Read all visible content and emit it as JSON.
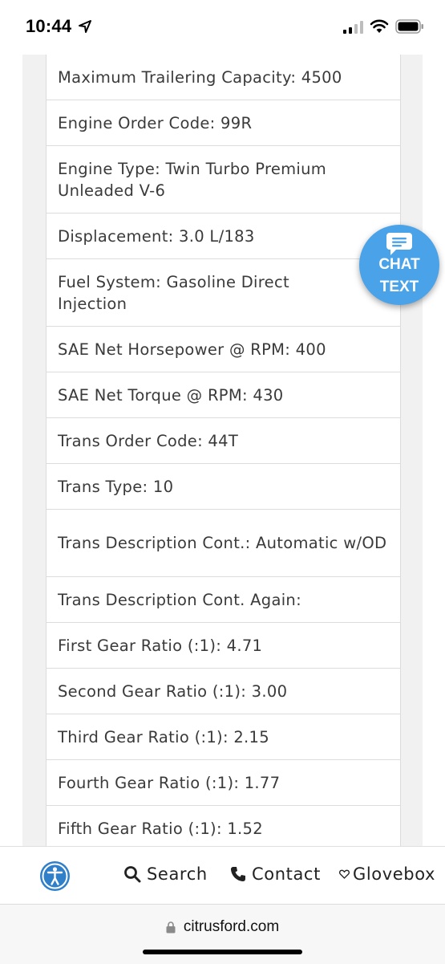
{
  "status_bar": {
    "time": "10:44",
    "icons": [
      "location-arrow-icon",
      "signal-icon",
      "wifi-icon",
      "battery-icon"
    ]
  },
  "specs": [
    {
      "text": "Maximum Trailering Capacity: 4500"
    },
    {
      "text": "Engine Order Code: 99R"
    },
    {
      "text": "Engine Type: Twin Turbo Premium Unleaded V-6"
    },
    {
      "text": "Displacement: 3.0 L/183"
    },
    {
      "text": "Fuel System: Gasoline Direct Injection"
    },
    {
      "text": "SAE Net Horsepower @ RPM: 400"
    },
    {
      "text": "SAE Net Torque @ RPM: 430"
    },
    {
      "text": "Trans Order Code: 44T"
    },
    {
      "text": "Trans Type: 10"
    },
    {
      "text": "Trans Description Cont.: Automatic w/OD"
    },
    {
      "text": "Trans Description Cont. Again:"
    },
    {
      "text": "First Gear Ratio (:1): 4.71"
    },
    {
      "text": "Second Gear Ratio (:1): 3.00"
    },
    {
      "text": "Third Gear Ratio (:1): 2.15"
    },
    {
      "text": "Fourth Gear Ratio (:1): 1.77"
    },
    {
      "text": "Fifth Gear Ratio (:1): 1.52"
    }
  ],
  "chat_widget": {
    "line1": "CHAT",
    "line2": "TEXT",
    "color": "#4aa3e8"
  },
  "bottom_nav": {
    "search_label": "Search",
    "contact_label": "Contact",
    "glovebox_label": "Glovebox",
    "accent": "#2f7fc9"
  },
  "url_bar": {
    "domain": "citrusford.com"
  }
}
